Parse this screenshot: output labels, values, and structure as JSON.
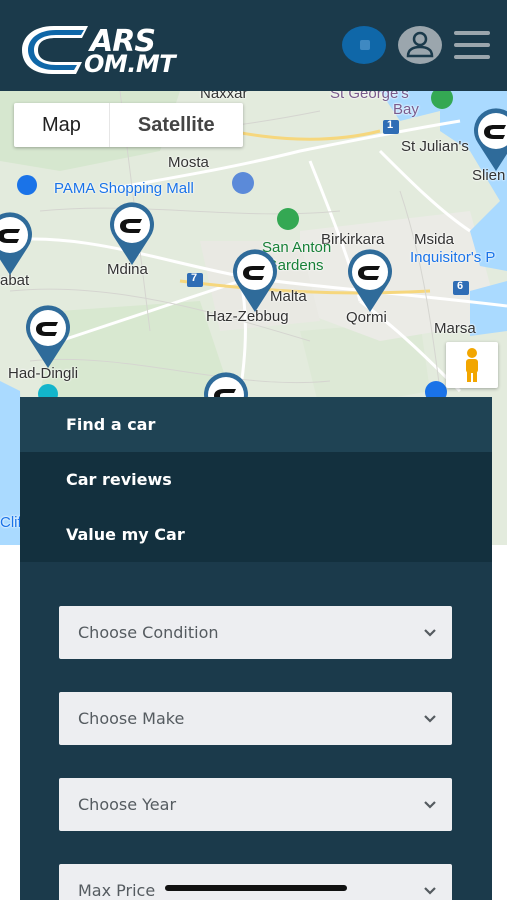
{
  "header": {
    "logo_top": "ARS",
    "logo_bottom": "OM.MT",
    "buttons": [
      "cart",
      "account",
      "menu"
    ]
  },
  "map": {
    "type_controls": {
      "map_label": "Map",
      "satellite_label": "Satellite"
    },
    "places": {
      "naxxar": "Naxxar",
      "st_georges_bay": "St George's",
      "bay": "Bay",
      "st_julians": "St Julian's",
      "sliema": "Slien",
      "mosta": "Mosta",
      "pama": "PAMA Shopping Mall",
      "birkirkara": "Birkirkara",
      "msida": "Msida",
      "inquisitors": "Inquisitor's P",
      "san_anton": "San Anton",
      "gardens": "Gardens",
      "mdina": "Mdina",
      "rabat": "abat",
      "malta": "Malta",
      "haz_zebbug": "Haz-Zebbug",
      "qormi": "Qormi",
      "marsa": "Marsa",
      "had_dingli": "Had-Dingli",
      "clif": "Clif",
      "road_1": "1",
      "road_6": "6",
      "road_7": "7"
    }
  },
  "nav": {
    "items": [
      {
        "label": "Find a car"
      },
      {
        "label": "Car reviews"
      },
      {
        "label": "Value my Car"
      }
    ]
  },
  "search": {
    "condition_placeholder": "Choose Condition",
    "make_placeholder": "Choose Make",
    "year_placeholder": "Choose Year",
    "price_placeholder": "Max Price"
  },
  "colors": {
    "header_bg": "#1b3a4b",
    "brand_blue": "#0f67a8",
    "panel_bg": "#1b3a4b",
    "nav_active": "#1f4354",
    "nav_dark": "#13303e",
    "select_bg": "#edeef1"
  }
}
